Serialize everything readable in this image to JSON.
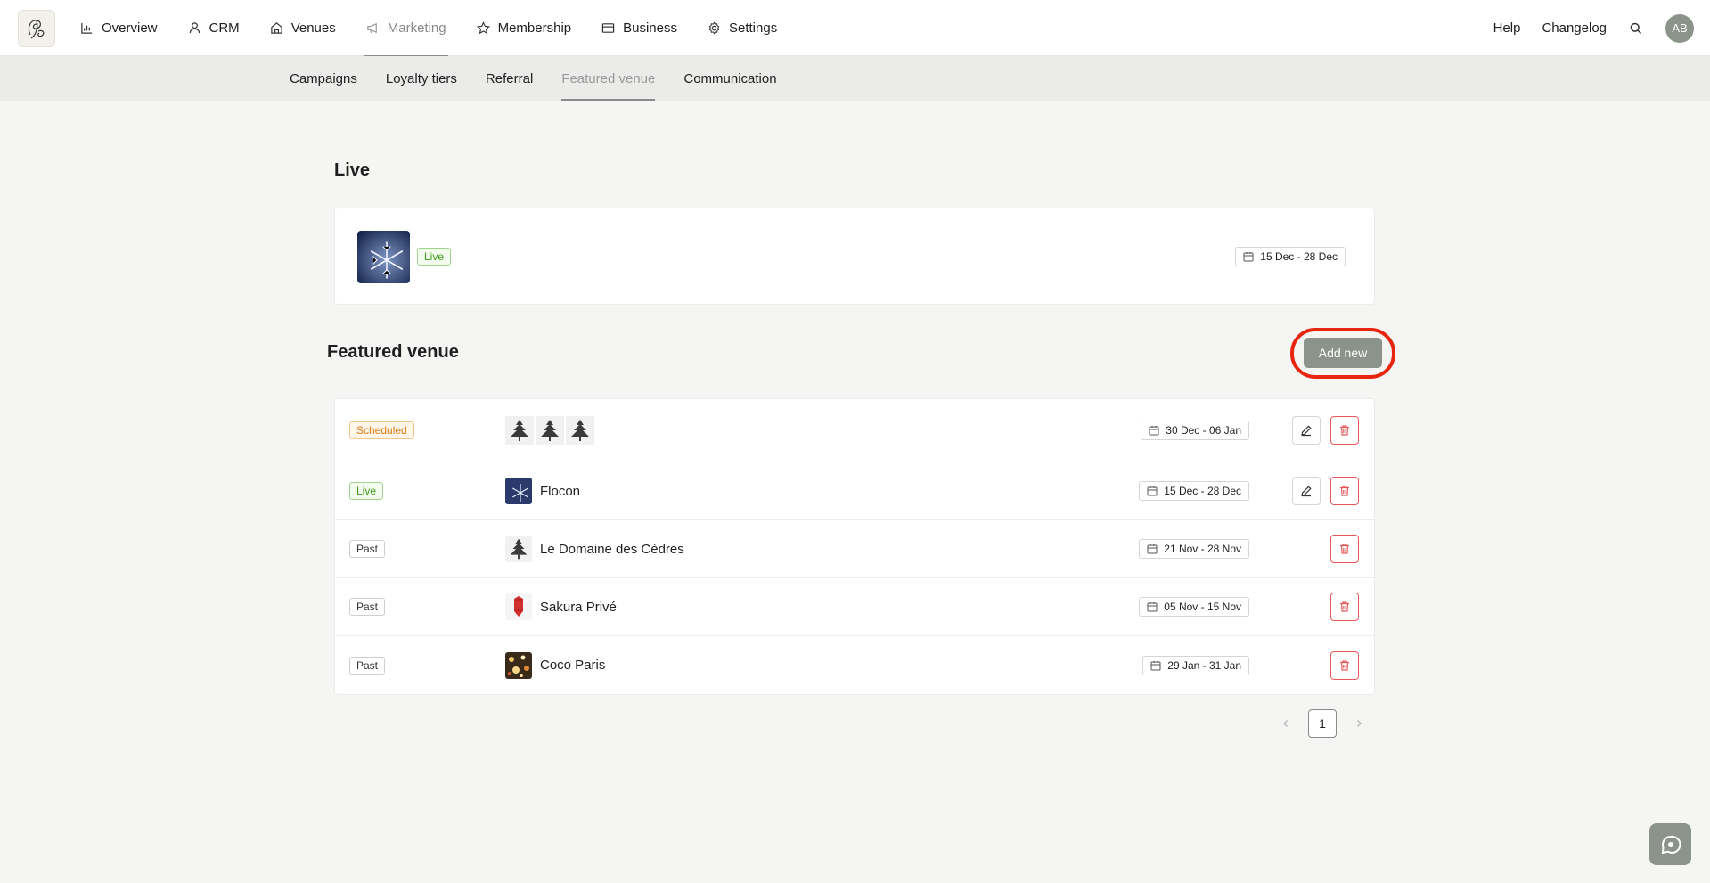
{
  "topnav": {
    "items": [
      {
        "label": "Overview",
        "icon": "chart-icon"
      },
      {
        "label": "CRM",
        "icon": "user-icon"
      },
      {
        "label": "Venues",
        "icon": "home-icon"
      },
      {
        "label": "Marketing",
        "icon": "megaphone-icon",
        "active": true
      },
      {
        "label": "Membership",
        "icon": "star-icon"
      },
      {
        "label": "Business",
        "icon": "card-icon"
      },
      {
        "label": "Settings",
        "icon": "gear-icon"
      }
    ],
    "help": "Help",
    "changelog": "Changelog",
    "avatar": "AB"
  },
  "subnav": {
    "items": [
      {
        "label": "Campaigns"
      },
      {
        "label": "Loyalty tiers"
      },
      {
        "label": "Referral"
      },
      {
        "label": "Featured venue",
        "active": true
      },
      {
        "label": "Communication"
      }
    ]
  },
  "live": {
    "title": "Live",
    "badge": "Live",
    "date": "15 Dec - 28 Dec"
  },
  "featured": {
    "title": "Featured venue",
    "add_label": "Add new",
    "rows": [
      {
        "status": "Scheduled",
        "venue": "",
        "date": "30 Dec - 06 Jan",
        "editable": true
      },
      {
        "status": "Live",
        "venue": "Flocon",
        "date": "15 Dec - 28 Dec",
        "editable": true
      },
      {
        "status": "Past",
        "venue": "Le Domaine des Cèdres",
        "date": "21 Nov - 28 Nov",
        "editable": false
      },
      {
        "status": "Past",
        "venue": "Sakura Privé",
        "date": "05 Nov - 15 Nov",
        "editable": false
      },
      {
        "status": "Past",
        "venue": "Coco Paris",
        "date": "29 Jan - 31 Jan",
        "editable": false
      }
    ]
  },
  "pagination": {
    "current": "1"
  },
  "colors": {
    "accent": "#8b938a",
    "live": "#3f9b1a",
    "scheduled": "#d97a16",
    "danger": "#e85a5a",
    "highlight_ring": "#e8250f"
  }
}
